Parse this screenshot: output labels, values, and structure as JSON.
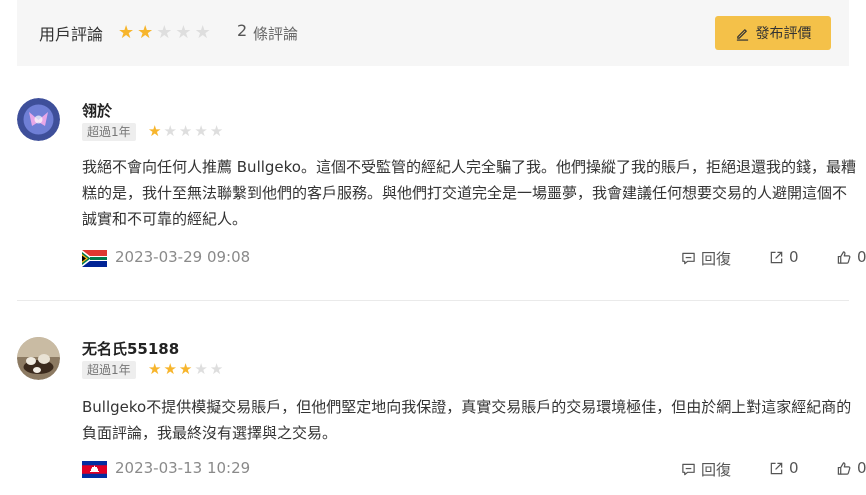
{
  "header": {
    "title": "用戶評論",
    "rating_stars": 2,
    "count": "2",
    "count_unit": "條評論",
    "post_button": "發布評價"
  },
  "colors": {
    "accent": "#f4c149",
    "star_on": "#f7b52c",
    "star_off": "#dedede"
  },
  "reviews": [
    {
      "name": "翎於",
      "badge": "超過1年",
      "stars": 1,
      "text": "我絕不會向任何人推薦 Bullgeko。這個不受監管的經紀人完全騙了我。他們操縱了我的賬戶，拒絕退還我的錢，最糟糕的是，我什至無法聯繫到他們的客戶服務。與他們打交道完全是一場噩夢，我會建議任何想要交易的人避開這個不誠實和不可靠的經紀人。",
      "flag": "south-africa-flag",
      "date": "2023-03-29 09:08",
      "reply_label": "回復",
      "share_count": "0",
      "like_count": "0"
    },
    {
      "name": "无名氏55188",
      "badge": "超過1年",
      "stars": 3,
      "text": "Bullgeko不提供模擬交易賬戶，但他們堅定地向我保證，真實交易賬戶的交易環境極佳，但由於網上對這家經紀商的負面評論，我最終沒有選擇與之交易。",
      "flag": "cambodia-flag",
      "date": "2023-03-13 10:29",
      "reply_label": "回復",
      "share_count": "0",
      "like_count": "0"
    }
  ]
}
